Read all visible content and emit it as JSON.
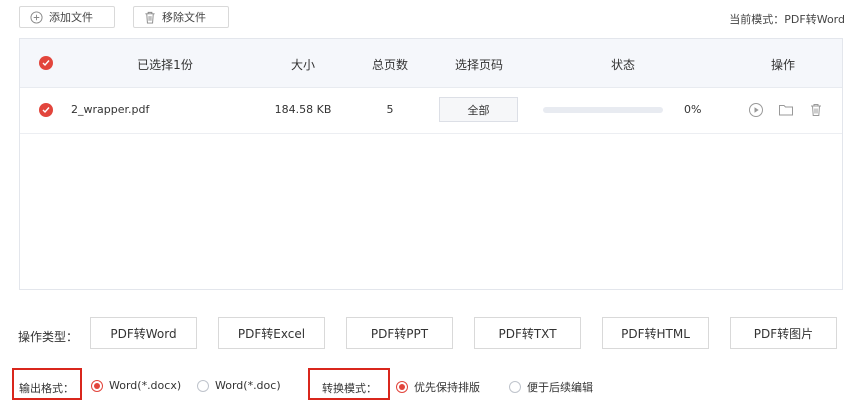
{
  "toolbar": {
    "add_label": "添加文件",
    "remove_label": "移除文件",
    "current_mode": "当前模式：PDF转Word"
  },
  "table": {
    "headers": {
      "selected": "已选择1份",
      "size": "大小",
      "pages": "总页数",
      "page_select": "选择页码",
      "status": "状态",
      "actions": "操作"
    },
    "rows": [
      {
        "name": "2_wrapper.pdf",
        "size": "184.58 KB",
        "pages": "5",
        "page_select": "全部",
        "progress_text": "0%",
        "progress_value": 0
      }
    ]
  },
  "operation": {
    "label": "操作类型：",
    "types": [
      "PDF转Word",
      "PDF转Excel",
      "PDF转PPT",
      "PDF转TXT",
      "PDF转HTML",
      "PDF转图片"
    ],
    "active_index": 0
  },
  "output": {
    "format_label": "输出格式：",
    "formats": [
      "Word(*.docx)",
      "Word(*.doc)"
    ],
    "format_selected": 0,
    "mode_label": "转换模式：",
    "modes": [
      "优先保持排版",
      "便于后续编辑"
    ],
    "mode_selected": 0
  },
  "colors": {
    "accent": "#e2453c",
    "highlight_box": "#d9261c"
  },
  "icons": {
    "add": "plus-circle-icon",
    "remove": "trash-icon",
    "play": "play-circle-icon",
    "folder": "folder-icon",
    "delete": "trash-icon",
    "check": "check-circle-icon"
  }
}
